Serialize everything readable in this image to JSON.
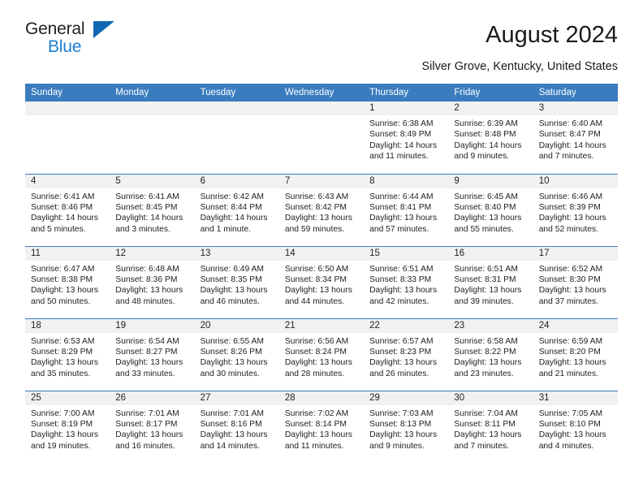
{
  "brand": {
    "name_part1": "General",
    "name_part2": "Blue",
    "logo_icon": "blue-triangle-icon"
  },
  "header": {
    "month_title": "August 2024",
    "location": "Silver Grove, Kentucky, United States"
  },
  "colors": {
    "header_blue": "#3a7dbf",
    "brand_blue": "#1b7fd4",
    "logo_blue": "#1167b1",
    "daynum_band": "#f1f1f1",
    "text": "#222222"
  },
  "weekday_headers": [
    "Sunday",
    "Monday",
    "Tuesday",
    "Wednesday",
    "Thursday",
    "Friday",
    "Saturday"
  ],
  "labels": {
    "sunrise": "Sunrise:",
    "sunset": "Sunset:",
    "daylight": "Daylight:"
  },
  "weeks": [
    [
      {
        "day": "",
        "empty": true
      },
      {
        "day": "",
        "empty": true
      },
      {
        "day": "",
        "empty": true
      },
      {
        "day": "",
        "empty": true
      },
      {
        "day": "1",
        "sunrise": "Sunrise: 6:38 AM",
        "sunset": "Sunset: 8:49 PM",
        "daylight_line1": "Daylight: 14 hours",
        "daylight_line2": "and 11 minutes."
      },
      {
        "day": "2",
        "sunrise": "Sunrise: 6:39 AM",
        "sunset": "Sunset: 8:48 PM",
        "daylight_line1": "Daylight: 14 hours",
        "daylight_line2": "and 9 minutes."
      },
      {
        "day": "3",
        "sunrise": "Sunrise: 6:40 AM",
        "sunset": "Sunset: 8:47 PM",
        "daylight_line1": "Daylight: 14 hours",
        "daylight_line2": "and 7 minutes."
      }
    ],
    [
      {
        "day": "4",
        "sunrise": "Sunrise: 6:41 AM",
        "sunset": "Sunset: 8:46 PM",
        "daylight_line1": "Daylight: 14 hours",
        "daylight_line2": "and 5 minutes."
      },
      {
        "day": "5",
        "sunrise": "Sunrise: 6:41 AM",
        "sunset": "Sunset: 8:45 PM",
        "daylight_line1": "Daylight: 14 hours",
        "daylight_line2": "and 3 minutes."
      },
      {
        "day": "6",
        "sunrise": "Sunrise: 6:42 AM",
        "sunset": "Sunset: 8:44 PM",
        "daylight_line1": "Daylight: 14 hours",
        "daylight_line2": "and 1 minute."
      },
      {
        "day": "7",
        "sunrise": "Sunrise: 6:43 AM",
        "sunset": "Sunset: 8:42 PM",
        "daylight_line1": "Daylight: 13 hours",
        "daylight_line2": "and 59 minutes."
      },
      {
        "day": "8",
        "sunrise": "Sunrise: 6:44 AM",
        "sunset": "Sunset: 8:41 PM",
        "daylight_line1": "Daylight: 13 hours",
        "daylight_line2": "and 57 minutes."
      },
      {
        "day": "9",
        "sunrise": "Sunrise: 6:45 AM",
        "sunset": "Sunset: 8:40 PM",
        "daylight_line1": "Daylight: 13 hours",
        "daylight_line2": "and 55 minutes."
      },
      {
        "day": "10",
        "sunrise": "Sunrise: 6:46 AM",
        "sunset": "Sunset: 8:39 PM",
        "daylight_line1": "Daylight: 13 hours",
        "daylight_line2": "and 52 minutes."
      }
    ],
    [
      {
        "day": "11",
        "sunrise": "Sunrise: 6:47 AM",
        "sunset": "Sunset: 8:38 PM",
        "daylight_line1": "Daylight: 13 hours",
        "daylight_line2": "and 50 minutes."
      },
      {
        "day": "12",
        "sunrise": "Sunrise: 6:48 AM",
        "sunset": "Sunset: 8:36 PM",
        "daylight_line1": "Daylight: 13 hours",
        "daylight_line2": "and 48 minutes."
      },
      {
        "day": "13",
        "sunrise": "Sunrise: 6:49 AM",
        "sunset": "Sunset: 8:35 PM",
        "daylight_line1": "Daylight: 13 hours",
        "daylight_line2": "and 46 minutes."
      },
      {
        "day": "14",
        "sunrise": "Sunrise: 6:50 AM",
        "sunset": "Sunset: 8:34 PM",
        "daylight_line1": "Daylight: 13 hours",
        "daylight_line2": "and 44 minutes."
      },
      {
        "day": "15",
        "sunrise": "Sunrise: 6:51 AM",
        "sunset": "Sunset: 8:33 PM",
        "daylight_line1": "Daylight: 13 hours",
        "daylight_line2": "and 42 minutes."
      },
      {
        "day": "16",
        "sunrise": "Sunrise: 6:51 AM",
        "sunset": "Sunset: 8:31 PM",
        "daylight_line1": "Daylight: 13 hours",
        "daylight_line2": "and 39 minutes."
      },
      {
        "day": "17",
        "sunrise": "Sunrise: 6:52 AM",
        "sunset": "Sunset: 8:30 PM",
        "daylight_line1": "Daylight: 13 hours",
        "daylight_line2": "and 37 minutes."
      }
    ],
    [
      {
        "day": "18",
        "sunrise": "Sunrise: 6:53 AM",
        "sunset": "Sunset: 8:29 PM",
        "daylight_line1": "Daylight: 13 hours",
        "daylight_line2": "and 35 minutes."
      },
      {
        "day": "19",
        "sunrise": "Sunrise: 6:54 AM",
        "sunset": "Sunset: 8:27 PM",
        "daylight_line1": "Daylight: 13 hours",
        "daylight_line2": "and 33 minutes."
      },
      {
        "day": "20",
        "sunrise": "Sunrise: 6:55 AM",
        "sunset": "Sunset: 8:26 PM",
        "daylight_line1": "Daylight: 13 hours",
        "daylight_line2": "and 30 minutes."
      },
      {
        "day": "21",
        "sunrise": "Sunrise: 6:56 AM",
        "sunset": "Sunset: 8:24 PM",
        "daylight_line1": "Daylight: 13 hours",
        "daylight_line2": "and 28 minutes."
      },
      {
        "day": "22",
        "sunrise": "Sunrise: 6:57 AM",
        "sunset": "Sunset: 8:23 PM",
        "daylight_line1": "Daylight: 13 hours",
        "daylight_line2": "and 26 minutes."
      },
      {
        "day": "23",
        "sunrise": "Sunrise: 6:58 AM",
        "sunset": "Sunset: 8:22 PM",
        "daylight_line1": "Daylight: 13 hours",
        "daylight_line2": "and 23 minutes."
      },
      {
        "day": "24",
        "sunrise": "Sunrise: 6:59 AM",
        "sunset": "Sunset: 8:20 PM",
        "daylight_line1": "Daylight: 13 hours",
        "daylight_line2": "and 21 minutes."
      }
    ],
    [
      {
        "day": "25",
        "sunrise": "Sunrise: 7:00 AM",
        "sunset": "Sunset: 8:19 PM",
        "daylight_line1": "Daylight: 13 hours",
        "daylight_line2": "and 19 minutes."
      },
      {
        "day": "26",
        "sunrise": "Sunrise: 7:01 AM",
        "sunset": "Sunset: 8:17 PM",
        "daylight_line1": "Daylight: 13 hours",
        "daylight_line2": "and 16 minutes."
      },
      {
        "day": "27",
        "sunrise": "Sunrise: 7:01 AM",
        "sunset": "Sunset: 8:16 PM",
        "daylight_line1": "Daylight: 13 hours",
        "daylight_line2": "and 14 minutes."
      },
      {
        "day": "28",
        "sunrise": "Sunrise: 7:02 AM",
        "sunset": "Sunset: 8:14 PM",
        "daylight_line1": "Daylight: 13 hours",
        "daylight_line2": "and 11 minutes."
      },
      {
        "day": "29",
        "sunrise": "Sunrise: 7:03 AM",
        "sunset": "Sunset: 8:13 PM",
        "daylight_line1": "Daylight: 13 hours",
        "daylight_line2": "and 9 minutes."
      },
      {
        "day": "30",
        "sunrise": "Sunrise: 7:04 AM",
        "sunset": "Sunset: 8:11 PM",
        "daylight_line1": "Daylight: 13 hours",
        "daylight_line2": "and 7 minutes."
      },
      {
        "day": "31",
        "sunrise": "Sunrise: 7:05 AM",
        "sunset": "Sunset: 8:10 PM",
        "daylight_line1": "Daylight: 13 hours",
        "daylight_line2": "and 4 minutes."
      }
    ]
  ]
}
